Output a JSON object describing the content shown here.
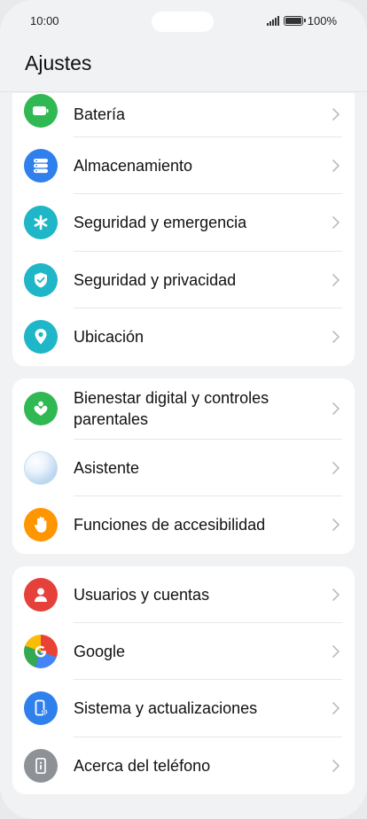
{
  "status": {
    "time": "10:00",
    "battery": "100%"
  },
  "header": {
    "title": "Ajustes"
  },
  "colors": {
    "green": "#30b852",
    "blue": "#2f80ed",
    "teal": "#1fb6c7",
    "orange": "#ff9500",
    "red": "#e5403a",
    "gray": "#8e9196"
  },
  "groups": [
    {
      "items": [
        {
          "label": "Batería",
          "icon": "battery-icon"
        },
        {
          "label": "Almacenamiento",
          "icon": "storage-icon"
        },
        {
          "label": "Seguridad y emergencia",
          "icon": "emergency-asterisk-icon"
        },
        {
          "label": "Seguridad y privacidad",
          "icon": "shield-check-icon"
        },
        {
          "label": "Ubicación",
          "icon": "location-pin-icon"
        }
      ]
    },
    {
      "items": [
        {
          "label": "Bienestar digital y controles parentales",
          "icon": "wellbeing-icon"
        },
        {
          "label": "Asistente",
          "icon": "assistant-orb-icon"
        },
        {
          "label": "Funciones de accesibilidad",
          "icon": "hand-icon"
        }
      ]
    },
    {
      "items": [
        {
          "label": "Usuarios y cuentas",
          "icon": "user-icon"
        },
        {
          "label": "Google",
          "icon": "google-icon"
        },
        {
          "label": "Sistema y actualizaciones",
          "icon": "system-update-icon"
        },
        {
          "label": "Acerca del teléfono",
          "icon": "info-icon"
        }
      ]
    }
  ]
}
